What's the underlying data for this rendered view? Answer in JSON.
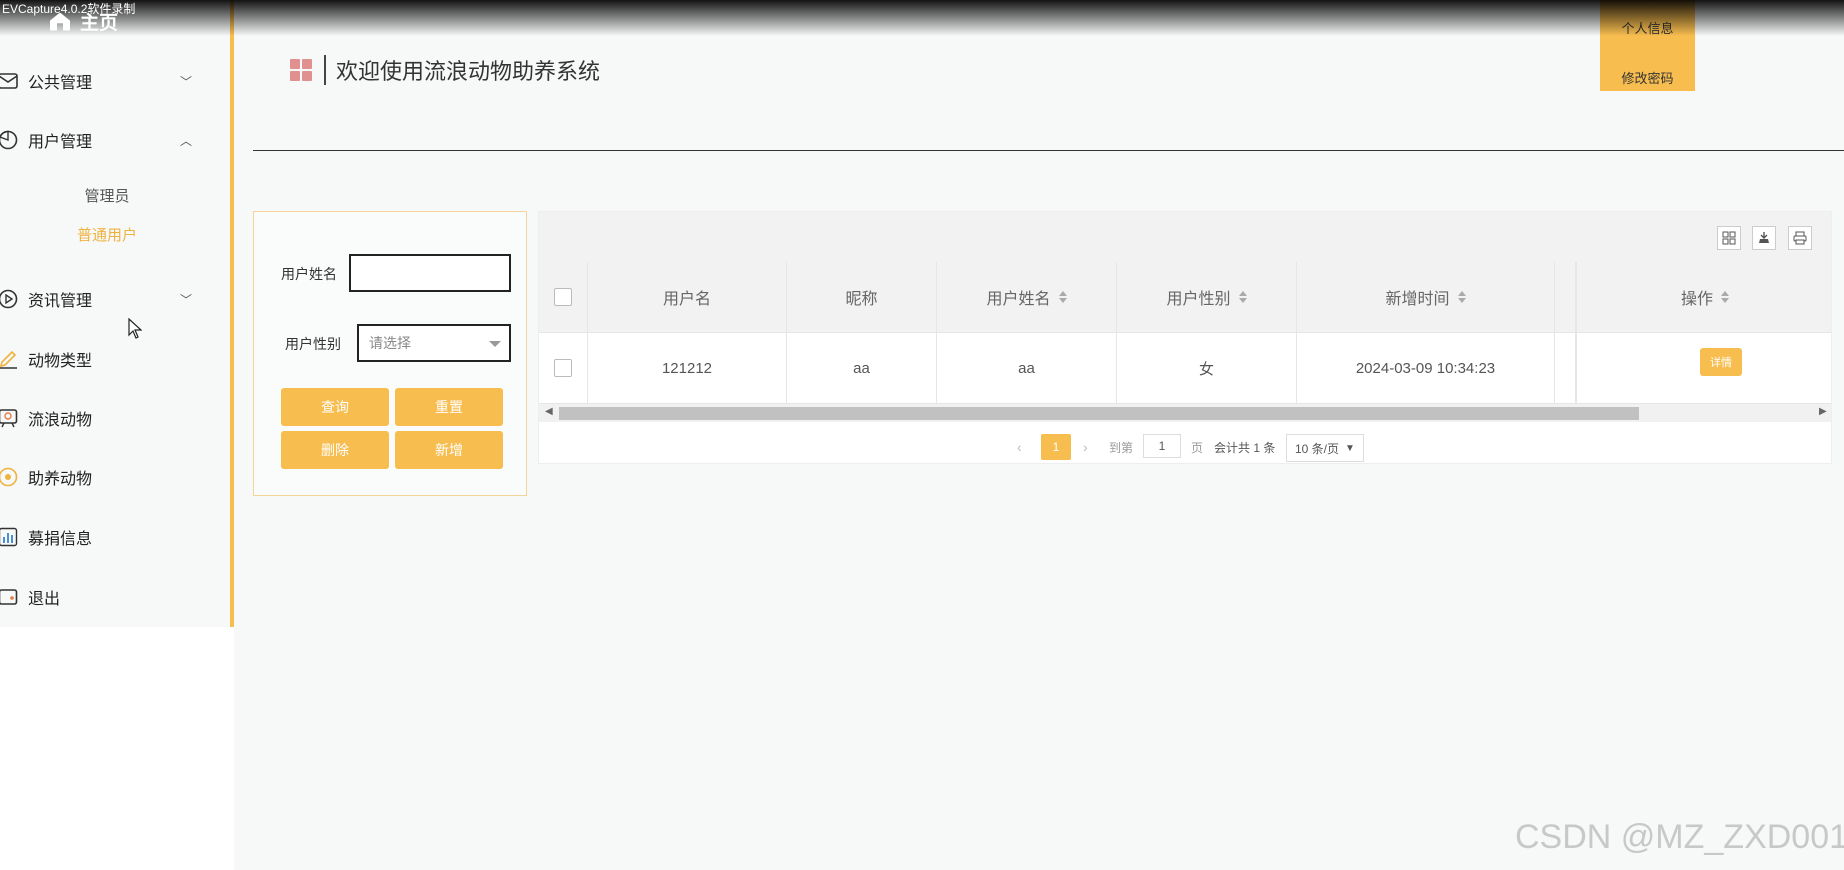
{
  "watermark_top": "EVCapture4.0.2软件录制",
  "watermark_bottom": "CSDN @MZ_ZXD001",
  "sidebar": {
    "home": "主页",
    "items": [
      {
        "label": "公共管理",
        "icon": "envelope-icon",
        "chevron": "down"
      },
      {
        "label": "用户管理",
        "icon": "pie-icon",
        "chevron": "up"
      },
      {
        "label": "资讯管理",
        "icon": "play-circle-icon",
        "chevron": "down"
      },
      {
        "label": "动物类型",
        "icon": "pencil-icon"
      },
      {
        "label": "流浪动物",
        "icon": "badge-icon"
      },
      {
        "label": "助养动物",
        "icon": "sun-icon"
      },
      {
        "label": "募捐信息",
        "icon": "bar-chart-icon"
      },
      {
        "label": "退出",
        "icon": "wallet-icon"
      }
    ],
    "sub_items": [
      {
        "label": "管理员",
        "active": false
      },
      {
        "label": "普通用户",
        "active": true
      }
    ]
  },
  "header": {
    "title": "欢迎使用流浪动物助养系统",
    "user_menu": [
      "个人信息",
      "修改密码"
    ]
  },
  "search": {
    "name_label": "用户姓名",
    "name_value": "",
    "gender_label": "用户性别",
    "gender_placeholder": "请选择",
    "buttons": {
      "query": "查询",
      "reset": "重置",
      "delete": "删除",
      "add": "新增"
    }
  },
  "table": {
    "columns": [
      "用户名",
      "昵称",
      "用户姓名",
      "用户性别",
      "新增时间",
      "操作"
    ],
    "rows": [
      {
        "username": "121212",
        "nickname": "aa",
        "realname": "aa",
        "gender": "女",
        "created": "2024-03-09 10:34:23",
        "action": "详情"
      }
    ]
  },
  "pagination": {
    "current": "1",
    "goto_label": "到第",
    "goto_value": "1",
    "page_unit": "页",
    "total": "会计共 1 条",
    "page_size": "10 条/页"
  },
  "colors": {
    "accent": "#f7bd4f",
    "title_icon": "#e0908f"
  }
}
